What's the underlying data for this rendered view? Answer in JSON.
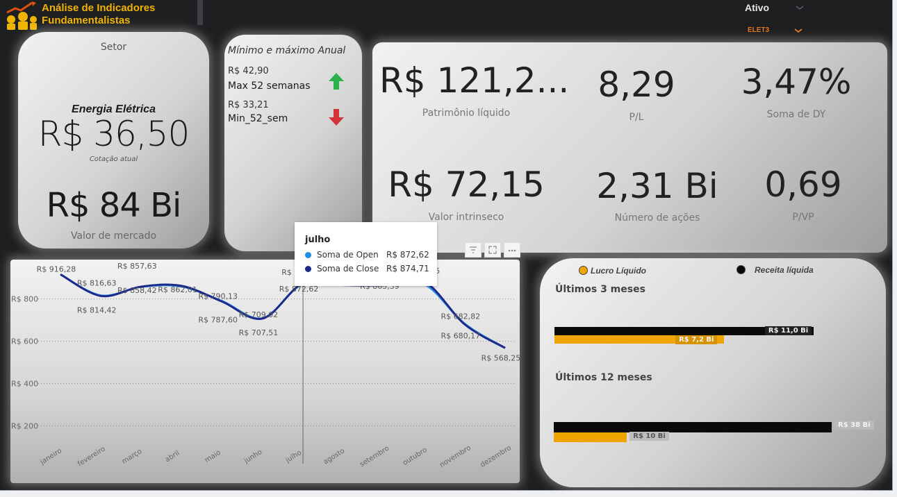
{
  "header": {
    "title_line1": "Análise de Indicadores",
    "title_line2": "Fundamentalistas",
    "slicer_label": "Ativo",
    "slicer_value": "ELET3"
  },
  "setor": {
    "title": "Setor",
    "name": "Energia Elétrica",
    "price": "R$ 36,50",
    "price_caption": "Cotação atual",
    "market_value": "R$ 84 Bi",
    "market_caption": "Valor de mercado"
  },
  "minmax": {
    "title": "Mínimo e máximo Anual",
    "max_value": "R$ 42,90",
    "max_label": "Max 52 semanas",
    "min_value": "R$ 33,21",
    "min_label": "Min_52_sem"
  },
  "kpis": {
    "equity": "R$ 121,2...",
    "equity_label": "Patrimônio líquido",
    "pl": "8,29",
    "pl_label": "P/L",
    "dy": "3,47%",
    "dy_label": "Soma de DY",
    "intrinsic": "R$ 72,15",
    "intrinsic_label": "Valor intrinseco",
    "shares": "2,31 Bi",
    "shares_label": "Número de ações",
    "pvp": "0,69",
    "pvp_label": "P/VP"
  },
  "tooltip": {
    "title": "julho",
    "rows": [
      {
        "name": "Soma de Open",
        "value": "R$ 872,62",
        "color": "#1f8fe5"
      },
      {
        "name": "Soma de Close",
        "value": "R$ 874,71",
        "color": "#1c2a8c"
      }
    ]
  },
  "visual_header": {
    "filter_icon": "filter-icon",
    "focus_icon": "focus-mode-icon",
    "more_icon": "more-options-icon"
  },
  "bars": {
    "legend": [
      {
        "label": "Lucro Líquido",
        "color": "#f0a400"
      },
      {
        "label": "Receita líquida",
        "color": "#0a0a0a"
      }
    ],
    "groups": [
      {
        "title": "Últimos 3 meses",
        "receita": 11.0,
        "receita_label": "R$ 11,0 Bi",
        "lucro": 7.2,
        "lucro_label": "R$ 7,2 Bi",
        "max": 11.8
      },
      {
        "title": "Últimos 12 meses",
        "receita": 38,
        "receita_label": "R$ 38 Bi",
        "lucro": 10,
        "lucro_label": "R$ 10 Bi",
        "max": 38
      }
    ]
  },
  "chart_data": {
    "type": "line",
    "categories": [
      "janeiro",
      "fevereiro",
      "março",
      "abril",
      "maio",
      "junho",
      "julho",
      "agosto",
      "setembro",
      "outubro",
      "novembro",
      "dezembro"
    ],
    "ylim": [
      100,
      960
    ],
    "yticks": [
      200,
      400,
      600,
      800
    ],
    "ytick_labels": [
      "R$ 200",
      "R$ 400",
      "R$ 600",
      "R$ 800"
    ],
    "grid": true,
    "series": [
      {
        "name": "Soma de Open",
        "color": "#1f8fe5",
        "values": [
          916.28,
          816.63,
          857.63,
          858.42,
          790.13,
          709.02,
          872.62,
          866.0,
          865.39,
          870.0,
          682.82,
          568.25
        ]
      },
      {
        "name": "Soma de Close",
        "color": "#1c2a8c",
        "values": [
          916.28,
          814.42,
          858.42,
          862.01,
          787.6,
          707.51,
          874.71,
          866.0,
          865.39,
          881.66,
          680.17,
          568.25
        ]
      }
    ],
    "point_labels": [
      {
        "i": 0,
        "text": "R$ 916,28",
        "dy": -4
      },
      {
        "i": 1,
        "text": "R$ 816,63",
        "dy": -15
      },
      {
        "i": 1,
        "text": "R$ 814,42",
        "dy": 24
      },
      {
        "i": 2,
        "text": "R$ 857,63",
        "dy": -26
      },
      {
        "i": 2,
        "text": "R$ 858,42",
        "dy": 9
      },
      {
        "i": 3,
        "text": "R$ 862,01",
        "dy": 9
      },
      {
        "i": 4,
        "text": "R$ 790,13",
        "dy": -4
      },
      {
        "i": 4,
        "text": "R$ 787,60",
        "dy": 30
      },
      {
        "i": 5,
        "text": "R$ 709,02",
        "dy": -2
      },
      {
        "i": 5,
        "text": "R$ 707,51",
        "dy": 24
      },
      {
        "i": 6,
        "text": "R$ 874,7",
        "dy": -12
      },
      {
        "i": 6,
        "text": "R$ 872,62",
        "dy": 12
      },
      {
        "i": 8,
        "text": "R$ 865,39",
        "dy": 5
      },
      {
        "i": 9,
        "text": "R$ 881,66",
        "dy": -12
      },
      {
        "i": 10,
        "text": "R$ 682,82",
        "dy": -8
      },
      {
        "i": 10,
        "text": "R$ 680,17",
        "dy": 20
      },
      {
        "i": 11,
        "text": "R$ 568,25",
        "dy": 18
      }
    ],
    "hover_category": "julho"
  }
}
